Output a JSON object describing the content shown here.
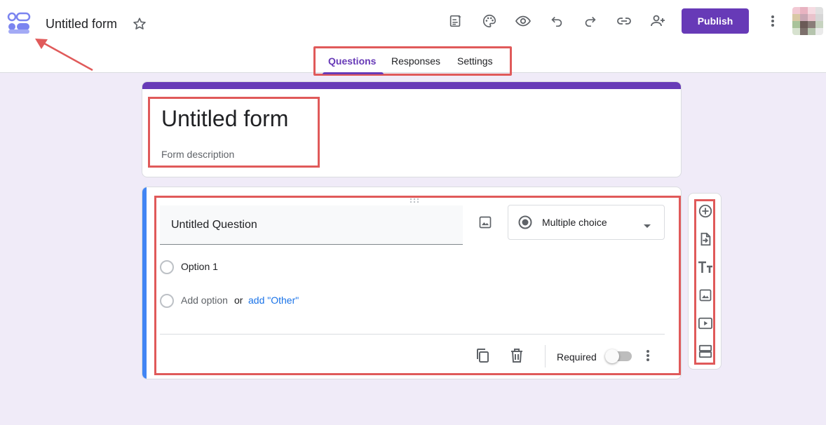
{
  "header": {
    "doc_title": "Untitled form",
    "publish_label": "Publish",
    "tabs": [
      {
        "label": "Questions"
      },
      {
        "label": "Responses"
      },
      {
        "label": "Settings"
      }
    ],
    "icons": [
      "customize-icon",
      "palette-icon",
      "preview-eye-icon",
      "undo-icon",
      "redo-icon",
      "link-icon",
      "add-collaborator-icon",
      "more-vert-icon"
    ],
    "accent_color": "#673ab7"
  },
  "title_card": {
    "title": "Untitled form",
    "description_placeholder": "Form description"
  },
  "question": {
    "title": "Untitled Question",
    "type_label": "Multiple choice",
    "option1": "Option 1",
    "add_option": "Add option",
    "or": "or",
    "add_other": "add \"Other\"",
    "required_label": "Required",
    "required_on": false
  },
  "side_toolbar": {
    "icons": [
      "add-question-icon",
      "import-questions-icon",
      "add-title-icon",
      "add-image-icon",
      "add-video-icon",
      "add-section-icon"
    ]
  }
}
